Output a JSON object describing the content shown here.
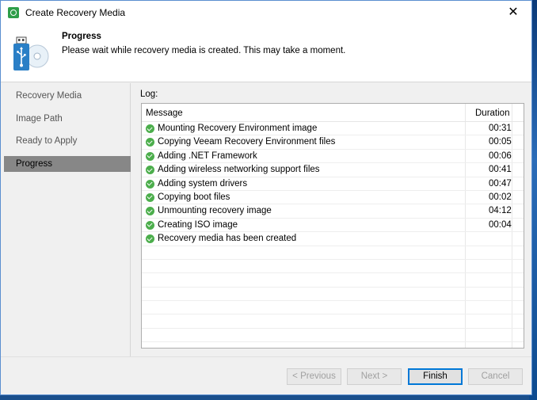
{
  "window": {
    "title": "Create Recovery Media",
    "close_glyph": "✕",
    "app_icon": "veeam-green-icon"
  },
  "header": {
    "title": "Progress",
    "description": "Please wait while recovery media is created. This may take a moment.",
    "icon": "usb-drive-disc-icon"
  },
  "nav": {
    "items": [
      {
        "label": "Recovery Media",
        "active": false
      },
      {
        "label": "Image Path",
        "active": false
      },
      {
        "label": "Ready to Apply",
        "active": false
      },
      {
        "label": "Progress",
        "active": true
      }
    ]
  },
  "log": {
    "label": "Log:",
    "columns": {
      "message": "Message",
      "duration": "Duration"
    },
    "rows": [
      {
        "message": "Mounting Recovery Environment image",
        "duration": "00:31"
      },
      {
        "message": "Copying Veeam Recovery Environment files",
        "duration": "00:05"
      },
      {
        "message": "Adding .NET Framework",
        "duration": "00:06"
      },
      {
        "message": "Adding wireless networking support files",
        "duration": "00:41"
      },
      {
        "message": "Adding system drivers",
        "duration": "00:47"
      },
      {
        "message": "Copying boot files",
        "duration": "00:02"
      },
      {
        "message": "Unmounting recovery image",
        "duration": "04:12"
      },
      {
        "message": "Creating ISO image",
        "duration": "00:04"
      },
      {
        "message": "Recovery media has been created",
        "duration": ""
      }
    ]
  },
  "buttons": {
    "previous": "< Previous",
    "next": "Next >",
    "finish": "Finish",
    "cancel": "Cancel"
  },
  "colors": {
    "success": "#4cae4c",
    "active_nav": "#878787",
    "accent": "#0078d7"
  }
}
